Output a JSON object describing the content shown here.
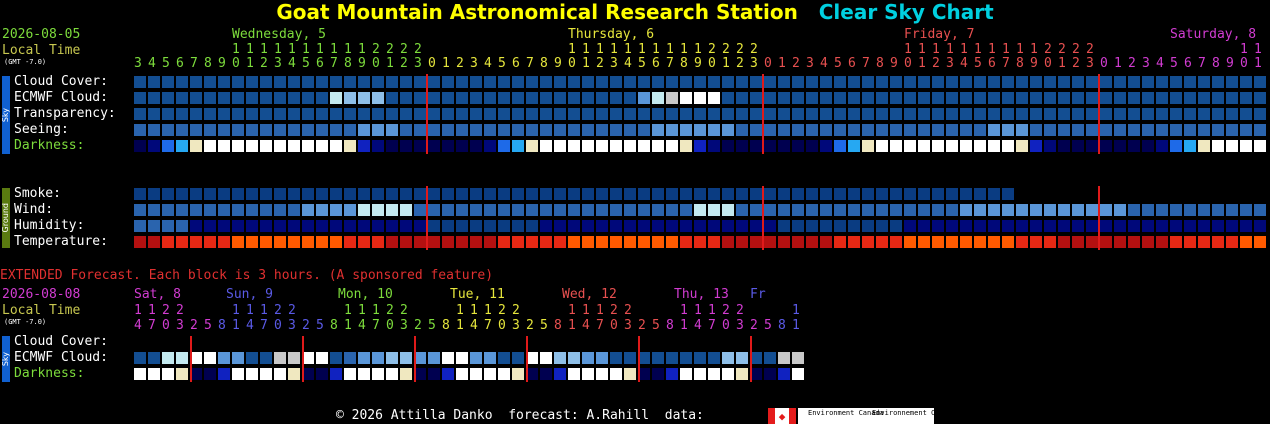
{
  "header": {
    "station": "Goat Mountain Astronomical Research Station",
    "chart": "Clear Sky Chart",
    "date": "2026-08-05",
    "local_time": "Local Time",
    "gmt": "(GMT -7.0)"
  },
  "days": [
    {
      "label": "Wednesday, 5",
      "color": "#7ddc3c"
    },
    {
      "label": "Thursday, 6",
      "color": "#e6e63c"
    },
    {
      "label": "Friday, 7",
      "color": "#e85050"
    },
    {
      "label": "Saturday, 8",
      "color": "#d23cd2"
    }
  ],
  "hours": [
    3,
    4,
    5,
    6,
    7,
    8,
    9,
    10,
    11,
    12,
    13,
    14,
    15,
    16,
    17,
    18,
    19,
    20,
    21,
    22,
    23,
    0,
    1,
    2,
    3,
    4,
    5,
    6,
    7,
    8,
    9,
    10,
    11,
    12,
    13,
    14,
    15,
    16,
    17,
    18,
    19,
    20,
    21,
    22,
    23,
    0,
    1,
    2,
    3,
    4,
    5,
    6,
    7,
    8,
    9,
    10,
    11,
    12,
    13,
    14,
    15,
    16,
    17,
    18,
    19,
    20,
    21,
    22,
    23,
    0,
    1,
    2,
    3,
    4,
    5,
    6,
    7,
    8,
    9,
    10,
    11
  ],
  "sky_label": "Sky",
  "ground_label": "Ground",
  "rows_main": [
    {
      "label": "Cloud Cover:"
    },
    {
      "label": "ECMWF Cloud:"
    },
    {
      "label": "Transparency:"
    },
    {
      "label": "Seeing:"
    },
    {
      "label": "Darkness:"
    }
  ],
  "rows_ground": [
    {
      "label": "Smoke:"
    },
    {
      "label": "Wind:"
    },
    {
      "label": "Humidity:"
    },
    {
      "label": "Temperature:"
    }
  ],
  "colors": {
    "clear": "#0a3c82",
    "clear2": "#134e92",
    "blue_mid": "#2a64ae",
    "blue_light": "#5a96d8",
    "blue_pale": "#8ebfe8",
    "pale_cyan": "#c4eaf0",
    "white": "#ffffff",
    "grey": "#c8c8c8",
    "dark_deep": "#000050",
    "dark_navy": "#00087a",
    "dark_blue": "#1022c0",
    "dark_bright": "#1e6ae8",
    "dark_cyan": "#26a8f2",
    "twilight": "#f0e8c0",
    "sun": "#ffffff",
    "temp_orange": "#ff5a00",
    "temp_red": "#e62814",
    "temp_dark": "#b41010",
    "temp_darker": "#8c0a0a",
    "smoke": "#0a3c82",
    "label_green": "#7ddc3c",
    "title_yellow": "#ffff00",
    "title_cyan": "#00d0e0",
    "ext_red": "#e03030",
    "sidebar_blue": "#1060d0",
    "sidebar_green": "#5a7a10"
  },
  "extended": {
    "title": "EXTENDED Forecast. Each block is 3 hours. (A sponsored feature)",
    "date": "2026-08-08",
    "local_time": "Local Time",
    "gmt": "(GMT -7.0)",
    "days": [
      {
        "label": "Sat, 8",
        "color": "#d23cd2"
      },
      {
        "label": "Sun, 9",
        "color": "#5a5ae6"
      },
      {
        "label": "Mon, 10",
        "color": "#7ddc3c"
      },
      {
        "label": "Tue, 11",
        "color": "#e6e63c"
      },
      {
        "label": "Wed, 12",
        "color": "#e85050"
      },
      {
        "label": "Thu, 13",
        "color": "#d23cd2"
      },
      {
        "label": "Fr",
        "color": "#5a5ae6"
      }
    ],
    "hours_top": "1122   11122   11122   11122   11122   11122   1",
    "hours_bottom": "470325814703258147032581470325814703258147032581",
    "rows": [
      {
        "label": "Cloud Cover:"
      },
      {
        "label": "ECMWF Cloud:"
      },
      {
        "label": "Darkness:"
      }
    ]
  },
  "footer": {
    "copyright": "© 2026 Attilla Danko",
    "forecast": "forecast: A.Rahill",
    "data": "data:",
    "logo_en": "Environment Canada",
    "logo_fr": "Environnement Canada"
  }
}
